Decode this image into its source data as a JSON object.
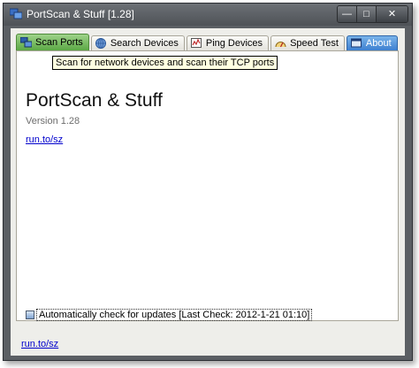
{
  "window": {
    "title": "PortScan & Stuff [1.28]",
    "app_icon": "portscan-app-icon",
    "controls": {
      "minimize": "—",
      "maximize": "□",
      "close": "✕"
    }
  },
  "tabs": [
    {
      "label": "Scan Ports",
      "icon": "scan-ports-icon",
      "state": "selected"
    },
    {
      "label": "Search Devices",
      "icon": "globe-icon",
      "state": "normal"
    },
    {
      "label": "Ping Devices",
      "icon": "ping-icon",
      "state": "normal"
    },
    {
      "label": "Speed Test",
      "icon": "speedometer-icon",
      "state": "normal"
    },
    {
      "label": "About",
      "icon": "about-icon",
      "state": "highlighted"
    }
  ],
  "tooltip": "Scan for network devices and scan their TCP ports",
  "about": {
    "app_name": "PortScan & Stuff",
    "version": "Version 1.28",
    "link": "run.to/sz",
    "auto_update_checked": true,
    "auto_update_label": "Automatically check for updates [Last Check: 2012-1-21 01:10]"
  },
  "footer": {
    "link": "run.to/sz"
  },
  "colors": {
    "selected_tab": "#5ba844",
    "about_tab": "#3d7fd0",
    "titlebar": "#5b5f64",
    "link": "#0000cc"
  }
}
